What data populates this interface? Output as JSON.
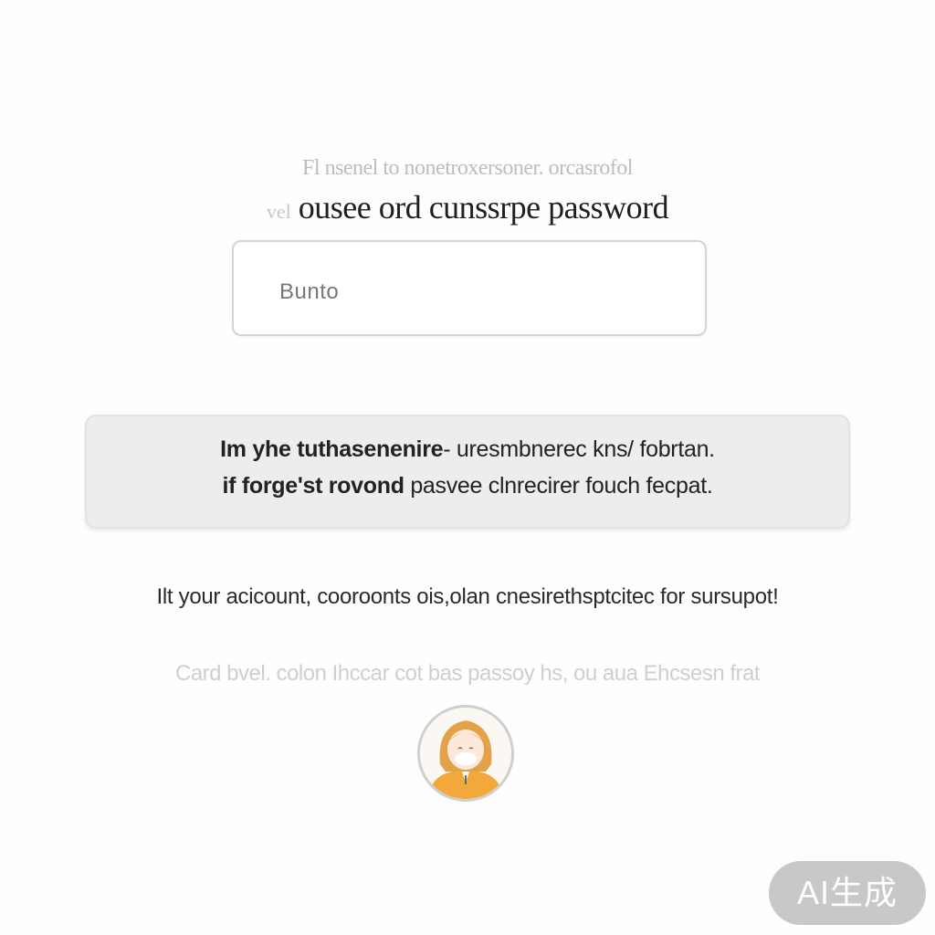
{
  "header": {
    "subtitle": "Fl nsenel to nonetroxersoner. orcasrofol",
    "title_prefix": "vel",
    "title": "ousee ord cunssrpe password"
  },
  "input": {
    "value": "Bunto"
  },
  "action_button": {
    "line1_bold": "Im yhe tuthasenenire",
    "line1_rest": "- uresmbnerec kns/ fobrtan.",
    "line2_bold": "if forge'st rovond",
    "line2_rest": "pasvee clnrecirer fouch fecpat."
  },
  "info": {
    "text": "Ilt your acicount, cooroonts ois,olan cnesirethsptcitec for sursupot!"
  },
  "faded": {
    "text": "Card bvel. colon Ihccar cot bas passoy hs, ou aua Ehcsesn frat"
  },
  "avatar": {
    "icon": "user-avatar-icon",
    "hair_color": "#e3a24a",
    "shirt_color": "#f2a83a"
  },
  "badge": {
    "label": "AI生成"
  }
}
